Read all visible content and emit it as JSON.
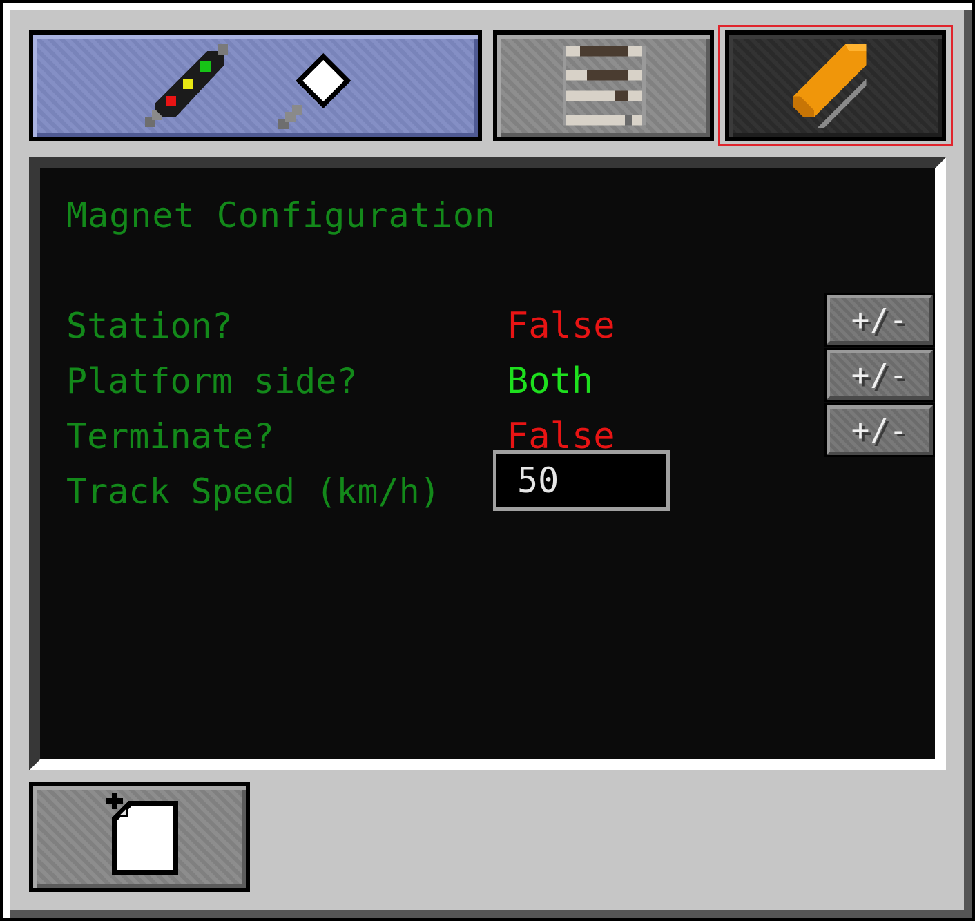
{
  "tabs": [
    {
      "id": "signals",
      "icon": "signal-icon",
      "icon2": "sign-icon",
      "selected": false
    },
    {
      "id": "tracks",
      "icon": "track-icon",
      "selected": false
    },
    {
      "id": "magnet",
      "icon": "magnet-icon",
      "selected": true
    }
  ],
  "panel": {
    "title": "Magnet Configuration",
    "settings": [
      {
        "label": "Station?",
        "value": "False",
        "button": "+/-"
      },
      {
        "label": "Platform side?",
        "value": "Both",
        "button": "+/-"
      },
      {
        "label": "Terminate?",
        "value": "False",
        "button": "+/-"
      },
      {
        "label": "Track Speed (km/h)",
        "value": "50"
      }
    ]
  },
  "footer": {
    "new_button_icon": "new-document-icon"
  },
  "colors": {
    "text_green": "#13891a",
    "value_false": "#e81414",
    "value_both": "#1ee01e",
    "selected_outline": "#e0242c"
  }
}
